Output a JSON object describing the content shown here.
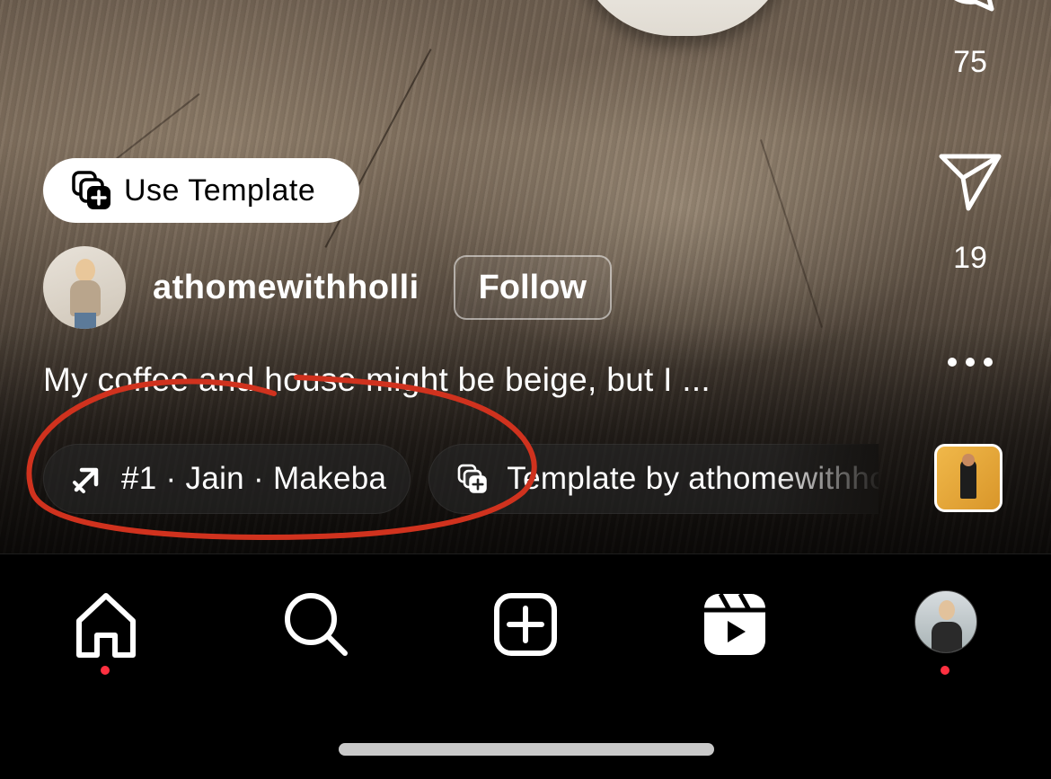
{
  "reel": {
    "use_template_label": "Use Template",
    "author": {
      "username": "athomewithholli",
      "follow_label": "Follow"
    },
    "caption": "My coffee and house might be beige, but I ...",
    "chips": [
      {
        "label": "#1 · Jain · Makeba",
        "icon": "trending-arrow-icon"
      },
      {
        "label": "Template by athomewithholli",
        "icon": "template-icon"
      }
    ]
  },
  "actions": {
    "comment_count": "75",
    "share_count": "19",
    "more_icon": "ellipsis-icon"
  },
  "tabbar": {
    "items": [
      {
        "name": "home",
        "icon": "home-icon",
        "badge_dot": true
      },
      {
        "name": "search",
        "icon": "search-icon",
        "badge_dot": false
      },
      {
        "name": "create",
        "icon": "plus-square-icon",
        "badge_dot": false
      },
      {
        "name": "reels",
        "icon": "reels-icon",
        "badge_dot": false
      },
      {
        "name": "profile",
        "icon": "avatar",
        "badge_dot": true
      }
    ]
  },
  "colors": {
    "background": "#000000",
    "notification_dot": "#ff3040",
    "annotation_red": "#d0321e"
  }
}
